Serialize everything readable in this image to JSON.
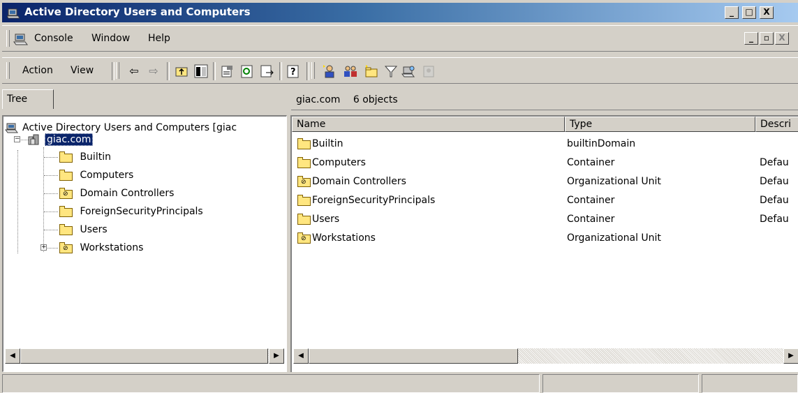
{
  "window": {
    "title": "Active Directory Users and Computers",
    "app_icon": "aduc-snapin-icon",
    "caption_buttons": [
      "_",
      "□",
      "X"
    ]
  },
  "menubar": {
    "items": [
      {
        "label": "Console",
        "accel": "C"
      },
      {
        "label": "Window",
        "accel": "W"
      },
      {
        "label": "Help",
        "accel": "H"
      }
    ],
    "mdi_buttons": [
      "_",
      "▫",
      "X"
    ]
  },
  "toolbar": {
    "action_label": "Action",
    "view_label": "View",
    "icons": [
      "back-arrow-icon",
      "forward-arrow-icon",
      "up-one-level-icon",
      "show-hide-tree-icon",
      "properties-icon",
      "refresh-icon",
      "export-list-icon",
      "help-icon",
      "create-user-icon",
      "create-group-icon",
      "create-ou-icon",
      "filter-icon",
      "find-icon",
      "add-to-group-icon"
    ]
  },
  "tree": {
    "tab_label": "Tree",
    "root_label": "Active Directory Users and Computers [giac",
    "domain_label": "giac.com",
    "children": [
      {
        "label": "Builtin",
        "icon": "folder-icon"
      },
      {
        "label": "Computers",
        "icon": "folder-icon"
      },
      {
        "label": "Domain Controllers",
        "icon": "ou-folder-icon"
      },
      {
        "label": "ForeignSecurityPrincipals",
        "icon": "folder-icon"
      },
      {
        "label": "Users",
        "icon": "folder-icon"
      },
      {
        "label": "Workstations",
        "icon": "ou-folder-icon",
        "expandable": true
      }
    ]
  },
  "list": {
    "location": "giac.com",
    "object_count": "6 objects",
    "columns": [
      "Name",
      "Type",
      "Descri"
    ],
    "rows": [
      {
        "name": "Builtin",
        "type": "builtinDomain",
        "desc": "",
        "icon": "folder-icon"
      },
      {
        "name": "Computers",
        "type": "Container",
        "desc": "Defau",
        "icon": "folder-icon"
      },
      {
        "name": "Domain Controllers",
        "type": "Organizational Unit",
        "desc": "Defau",
        "icon": "ou-folder-icon"
      },
      {
        "name": "ForeignSecurityPrincipals",
        "type": "Container",
        "desc": "Defau",
        "icon": "folder-icon"
      },
      {
        "name": "Users",
        "type": "Container",
        "desc": "Defau",
        "icon": "folder-icon"
      },
      {
        "name": "Workstations",
        "type": "Organizational Unit",
        "desc": "",
        "icon": "ou-folder-icon"
      }
    ]
  },
  "colors": {
    "title_gradient_start": "#0a246a",
    "title_gradient_end": "#a6caf0",
    "chrome": "#d4d0c8",
    "selection": "#0a246a"
  }
}
